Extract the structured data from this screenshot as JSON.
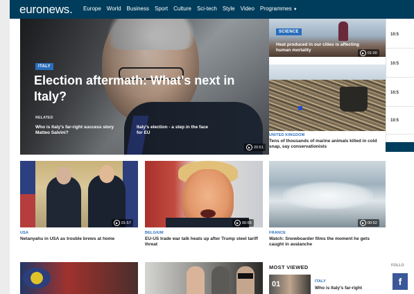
{
  "nav": {
    "logo": "euronews.",
    "links": [
      "Europe",
      "World",
      "Business",
      "Sport",
      "Culture",
      "Sci-tech",
      "Style",
      "Video",
      "Programmes"
    ]
  },
  "hero": {
    "tag": "ITALY",
    "title": "Election aftermath: What's next in Italy?",
    "related_label": "RELATED",
    "related": [
      "Who is Italy's far-right success story Matteo Salvini?",
      "Italy's election - a step in the face for EU"
    ],
    "duration": "20:51"
  },
  "heat": {
    "tag": "SCIENCE",
    "title": "Heat produced in our cities is affecting human mortality",
    "duration": "01:00"
  },
  "plastic": {
    "region": "UNITED KINGDOM",
    "title": "Tens of thousands of marine animals killed in cold snap, say conservationists"
  },
  "sidebox": [
    "10:5",
    "10:5",
    "10:5",
    "10:5"
  ],
  "bibi": {
    "region": "USA",
    "title": "Netanyahu in USA as trouble brews at home",
    "duration": "01:57"
  },
  "trump": {
    "region": "BELGIUM",
    "title": "EU-US trade war talk heats up after Trump steel tariff threat",
    "duration": "00:55"
  },
  "snow": {
    "region": "FRANCE",
    "title": "Watch: Snowboarder films the moment he gets caught in avalanche",
    "duration": "00:52"
  },
  "most_viewed": {
    "heading": "MOST VIEWED",
    "item": {
      "number": "01",
      "region": "ITALY",
      "title": "Who is Italy's far-right"
    }
  },
  "follow": {
    "label": "FOLLO",
    "fb": "f"
  }
}
